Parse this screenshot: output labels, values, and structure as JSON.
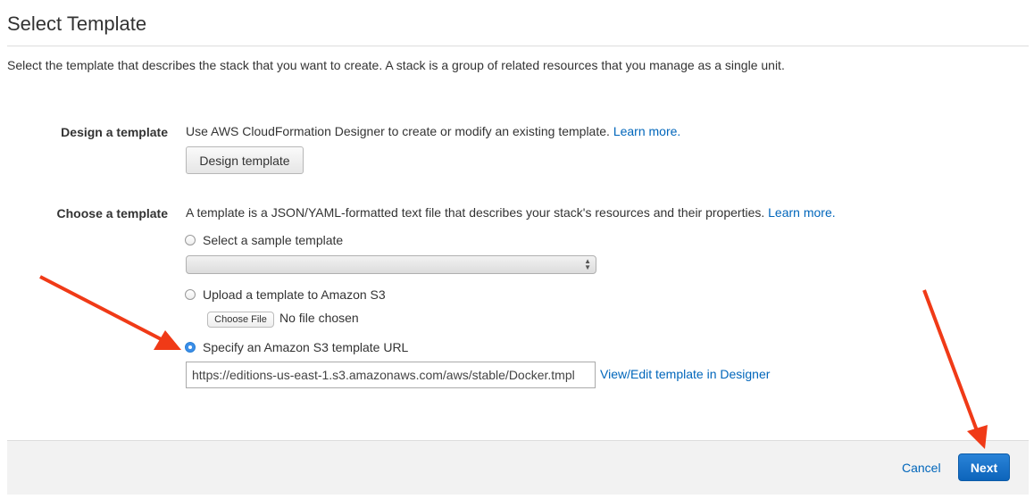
{
  "page": {
    "title": "Select Template",
    "description": "Select the template that describes the stack that you want to create. A stack is a group of related resources that you manage as a single unit."
  },
  "design_section": {
    "label": "Design a template",
    "text": "Use AWS CloudFormation Designer to create or modify an existing template.",
    "learn_more": "Learn more.",
    "button": "Design template"
  },
  "choose_section": {
    "label": "Choose a template",
    "text": "A template is a JSON/YAML-formatted text file that describes your stack's resources and their properties.",
    "learn_more": "Learn more.",
    "options": {
      "sample": {
        "label": "Select a sample template",
        "selected": false,
        "dropdown_value": ""
      },
      "upload": {
        "label": "Upload a template to Amazon S3",
        "selected": false,
        "file_button": "Choose File",
        "file_status": "No file chosen"
      },
      "url": {
        "label": "Specify an Amazon S3 template URL",
        "selected": true,
        "value": "https://editions-us-east-1.s3.amazonaws.com/aws/stable/Docker.tmpl",
        "designer_link": "View/Edit template in Designer"
      }
    }
  },
  "footer": {
    "cancel": "Cancel",
    "next": "Next"
  },
  "colors": {
    "link": "#0066bb",
    "primary_button": "#1166bb",
    "annotation_arrow": "#f03a17"
  },
  "annotations": {
    "arrows": [
      "red-arrow-icon",
      "red-arrow-icon"
    ]
  }
}
